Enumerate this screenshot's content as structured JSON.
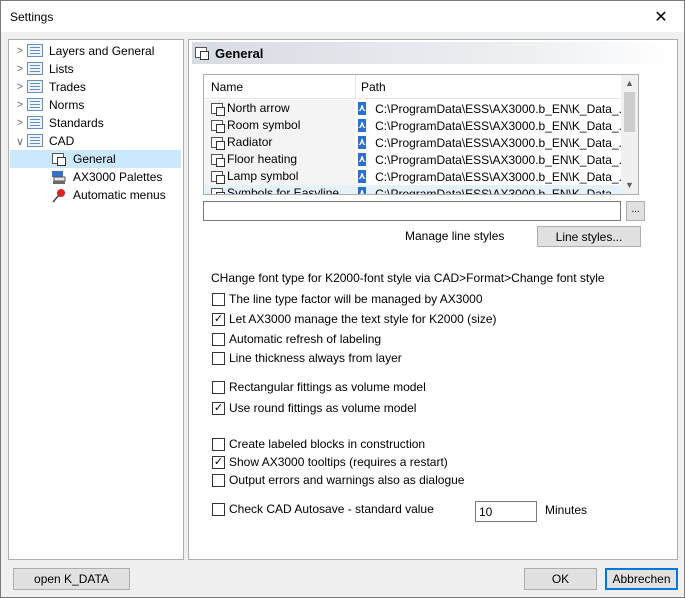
{
  "window": {
    "title": "Settings",
    "close_symbol": "✕"
  },
  "tree": {
    "items": [
      {
        "label": "Layers and General",
        "arrow": ">",
        "icon": "list-icon"
      },
      {
        "label": "Lists",
        "arrow": ">",
        "icon": "list-icon"
      },
      {
        "label": "Trades",
        "arrow": ">",
        "icon": "list-icon"
      },
      {
        "label": "Norms",
        "arrow": ">",
        "icon": "list-icon"
      },
      {
        "label": "Standards",
        "arrow": ">",
        "icon": "list-icon"
      },
      {
        "label": "CAD",
        "arrow": "∨",
        "icon": "list-icon"
      },
      {
        "label": "General",
        "icon": "general-icon",
        "selected": true
      },
      {
        "label": "AX3000 Palettes",
        "icon": "palette-icon"
      },
      {
        "label": "Automatic menus",
        "icon": "pin-icon"
      }
    ]
  },
  "panel": {
    "title": "General",
    "table": {
      "headers": {
        "name": "Name",
        "path": "Path"
      },
      "rows": [
        {
          "name": "North arrow",
          "path": "C:\\ProgramData\\ESS\\AX3000.b_EN\\K_Data_..."
        },
        {
          "name": "Room symbol",
          "path": "C:\\ProgramData\\ESS\\AX3000.b_EN\\K_Data_..."
        },
        {
          "name": "Radiator",
          "path": "C:\\ProgramData\\ESS\\AX3000.b_EN\\K_Data_..."
        },
        {
          "name": "Floor heating",
          "path": "C:\\ProgramData\\ESS\\AX3000.b_EN\\K_Data_..."
        },
        {
          "name": "Lamp symbol",
          "path": "C:\\ProgramData\\ESS\\AX3000.b_EN\\K_Data_..."
        },
        {
          "name": "Symbols for Easyline",
          "path": "C:\\ProgramData\\ESS\\AX3000.b_EN\\K_Data_..."
        }
      ]
    },
    "path_input_value": "",
    "browse_label": "...",
    "manage_line_styles_label": "Manage line styles",
    "line_styles_button": "Line styles...",
    "font_type_text": "CHange font type for K2000-font style via CAD>Format>Change font style",
    "checkboxes": [
      {
        "label": "The line type factor will be managed by AX3000",
        "checked": false
      },
      {
        "label": "Let AX3000 manage the text style for K2000 (size)",
        "checked": true
      },
      {
        "label": "Automatic refresh of labeling",
        "checked": false
      },
      {
        "label": "Line thickness always from layer",
        "checked": false
      },
      {
        "label": "Rectangular fittings as volume model",
        "checked": false
      },
      {
        "label": "Use round fittings as volume model",
        "checked": true
      },
      {
        "label": "Create labeled blocks in construction",
        "checked": false
      },
      {
        "label": "Show AX3000 tooltips (requires a restart)",
        "checked": true
      },
      {
        "label": "Output errors and warnings also as dialogue",
        "checked": false
      },
      {
        "label": "Check CAD Autosave - standard value",
        "checked": false
      }
    ],
    "autosave_value": "10",
    "minutes_label": "Minutes"
  },
  "footer": {
    "open_kdata_button": "open K_DATA",
    "ok_button": "OK",
    "cancel_button": "Abbrechen"
  }
}
